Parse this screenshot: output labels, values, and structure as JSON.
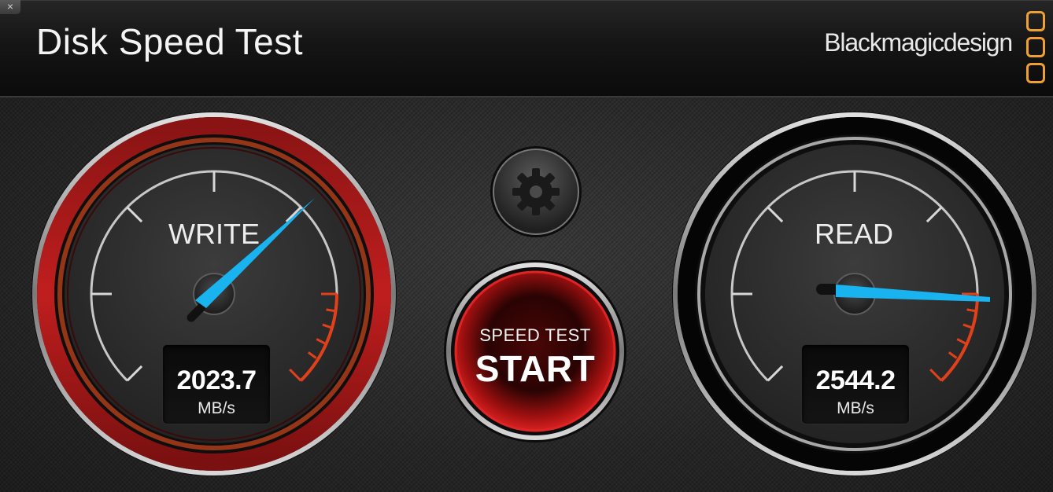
{
  "window": {
    "close_glyph": "×"
  },
  "header": {
    "title": "Disk Speed Test",
    "brand": "Blackmagicdesign"
  },
  "write": {
    "label": "WRITE",
    "value": "2023.7",
    "unit": "MB/s"
  },
  "read": {
    "label": "READ",
    "value": "2544.2",
    "unit": "MB/s"
  },
  "start_button": {
    "top_label": "SPEED TEST",
    "main_label": "START"
  },
  "settings_button": {
    "icon": "gear-icon"
  },
  "colors": {
    "needle": "#19b4f0",
    "write_ring": "#b81818",
    "redline": "#e0401a",
    "brand_logo": "#f0a030"
  }
}
